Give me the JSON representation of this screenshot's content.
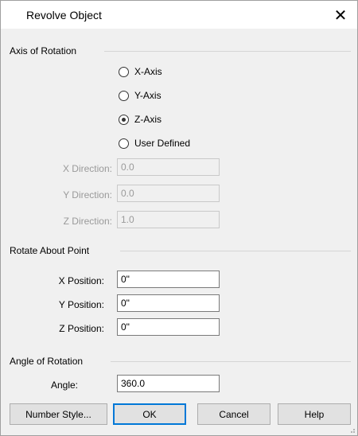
{
  "window": {
    "title": "Revolve Object",
    "close_icon": "close-icon"
  },
  "axis_group": {
    "label": "Axis of Rotation",
    "options": [
      {
        "label": "X-Axis",
        "checked": false
      },
      {
        "label": "Y-Axis",
        "checked": false
      },
      {
        "label": "Z-Axis",
        "checked": true
      },
      {
        "label": "User Defined",
        "checked": false
      }
    ],
    "fields": [
      {
        "label": "X Direction:",
        "value": "0.0"
      },
      {
        "label": "Y Direction:",
        "value": "0.0"
      },
      {
        "label": "Z Direction:",
        "value": "1.0"
      }
    ]
  },
  "point_group": {
    "label": "Rotate About Point",
    "fields": [
      {
        "label": "X Position:",
        "value": "0\""
      },
      {
        "label": "Y Position:",
        "value": "0\""
      },
      {
        "label": "Z Position:",
        "value": "0\""
      }
    ]
  },
  "angle_group": {
    "label": "Angle of Rotation",
    "angle_label": "Angle:",
    "angle_value": "360.0"
  },
  "buttons": {
    "number_style": "Number Style...",
    "ok": "OK",
    "cancel": "Cancel",
    "help": "Help"
  },
  "colors": {
    "accent": "#0078d7",
    "disabled_text": "#9a9a9a"
  }
}
